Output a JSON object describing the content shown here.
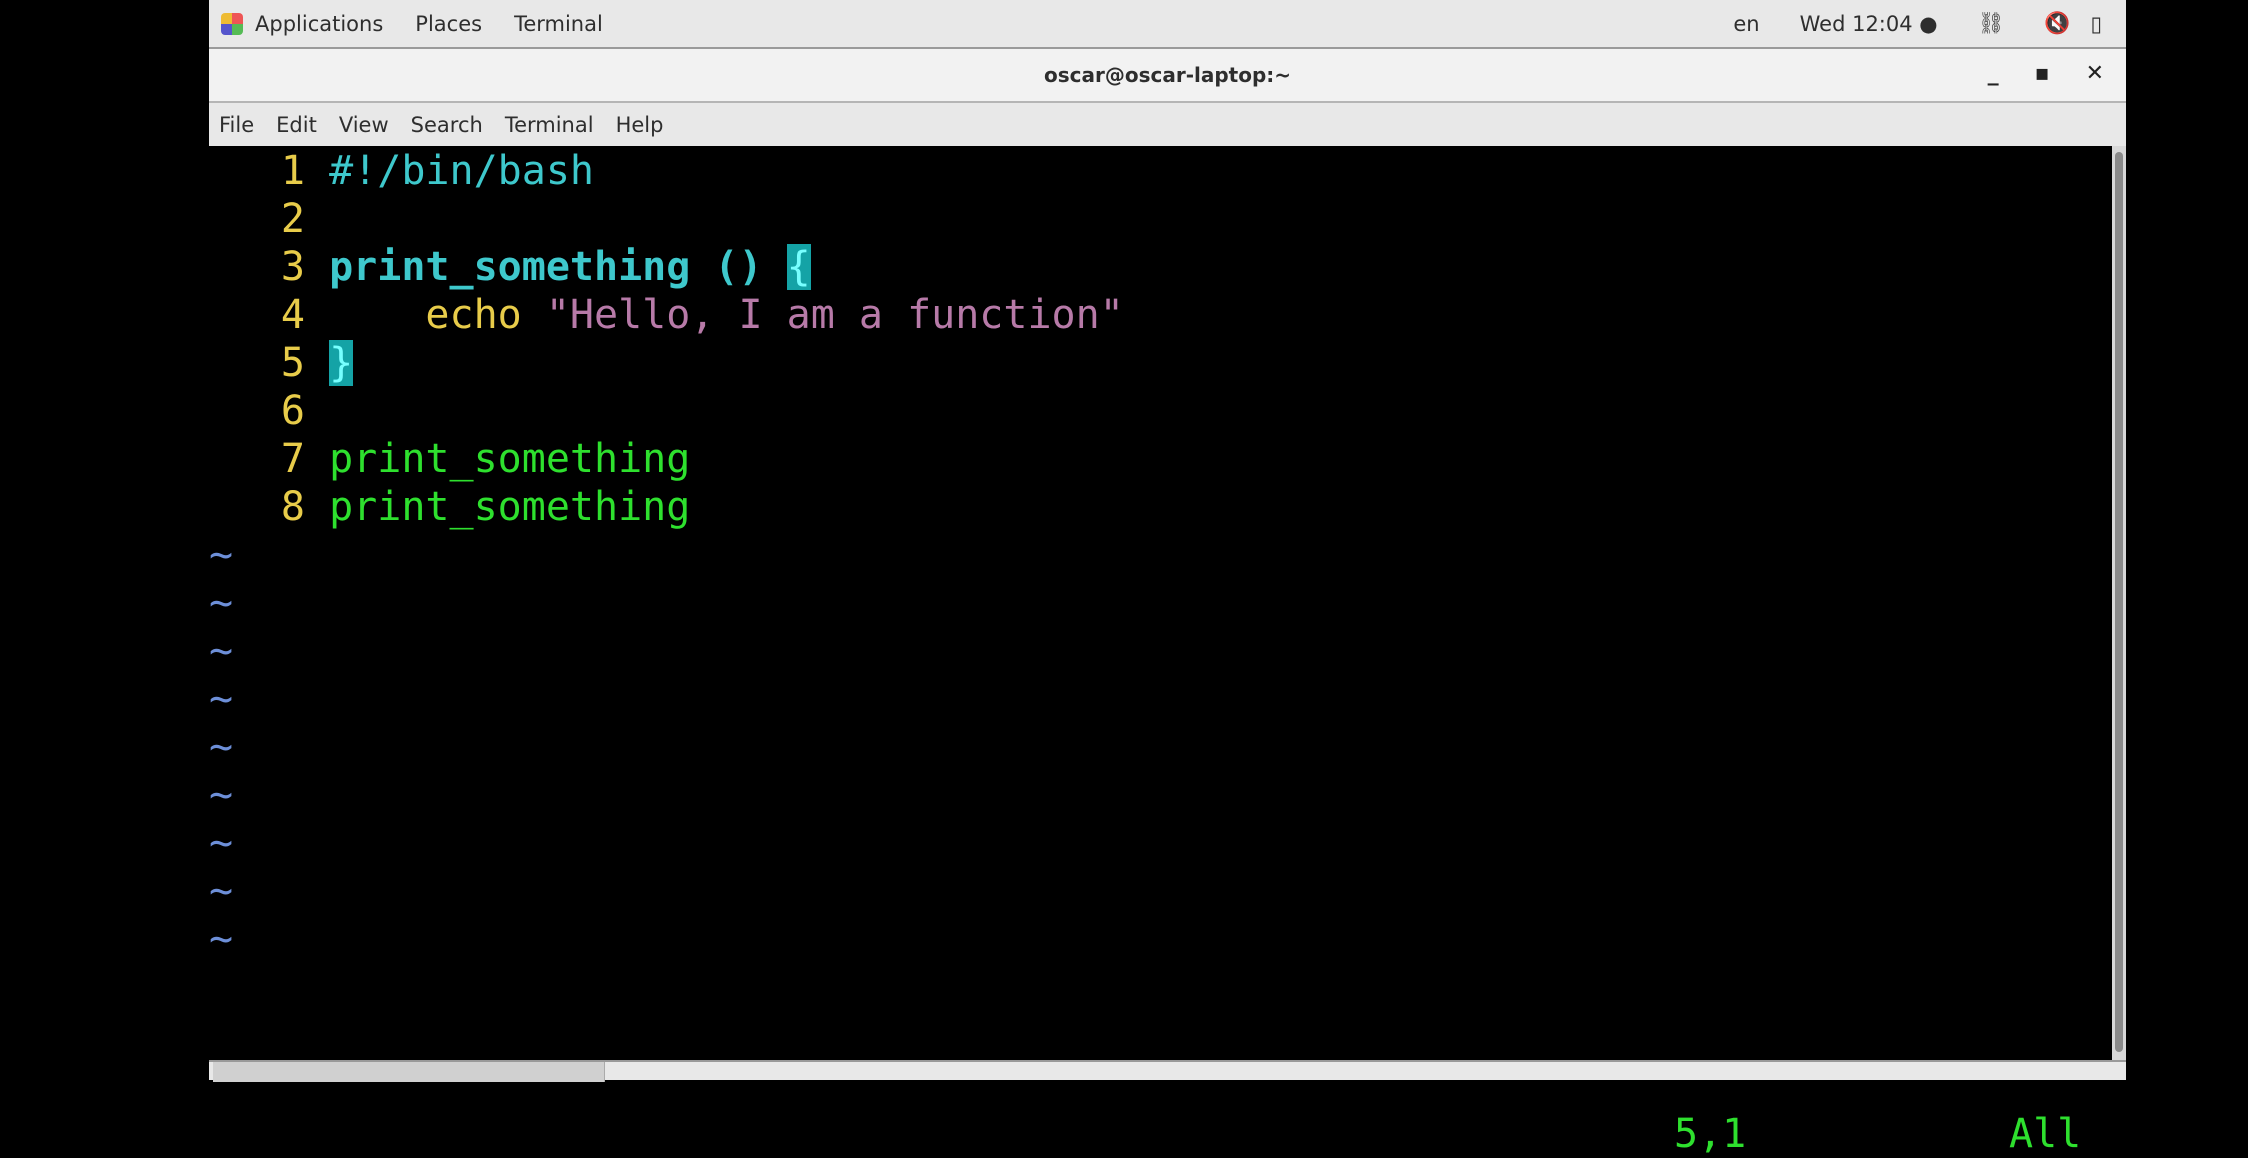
{
  "topbar": {
    "applications": "Applications",
    "places": "Places",
    "terminal": "Terminal",
    "lang": "en",
    "clock": "Wed 12:04 ●"
  },
  "window": {
    "title": "oscar@oscar-laptop:~",
    "minimize": "_",
    "maximize": "▪",
    "close": "✕"
  },
  "menu": [
    "File",
    "Edit",
    "View",
    "Search",
    "Terminal",
    "Help"
  ],
  "editor": {
    "lines": [
      {
        "n": "1",
        "text": "#!/bin/bash"
      },
      {
        "n": "2",
        "text": ""
      },
      {
        "n": "3",
        "name": "print_something",
        "paren": " () ",
        "brace": "{"
      },
      {
        "n": "4",
        "indent": "    ",
        "cmd": "echo",
        "str": " \"Hello, I am a function\""
      },
      {
        "n": "5",
        "brace": "}"
      },
      {
        "n": "6",
        "text": ""
      },
      {
        "n": "7",
        "text": "print_something"
      },
      {
        "n": "8",
        "text": "print_something"
      }
    ],
    "tilde": "~",
    "cursor_pos": "5,1",
    "scroll_pos": "All"
  },
  "colors": {
    "line_number": "#e8cc4a",
    "keyword": "#3ec8cc",
    "match_bg": "#14a3a6",
    "string": "#b77aa8",
    "call": "#2ee02e",
    "tilde": "#6d8fd8"
  }
}
